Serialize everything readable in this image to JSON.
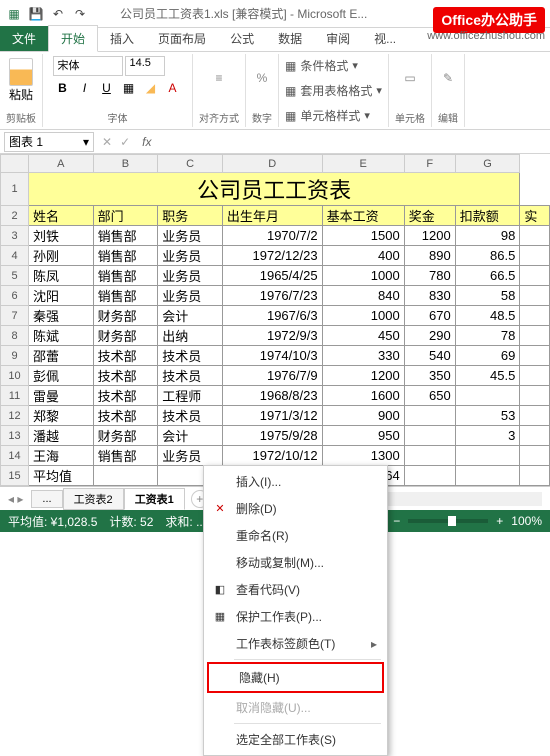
{
  "title": "公司员工工资表1.xls [兼容模式] - Microsoft E...",
  "watermark": "Office办公助手",
  "watermark_url": "www.officezhushou.com",
  "tabs": {
    "file": "文件",
    "home": "开始",
    "insert": "插入",
    "layout": "页面布局",
    "formula": "公式",
    "data": "数据",
    "review": "审阅",
    "view": "视..."
  },
  "ribbon": {
    "clipboard": "剪贴板",
    "paste": "粘贴",
    "font": "字体",
    "font_name": "宋体",
    "font_size": "14.5",
    "align": "对齐方式",
    "number": "数字",
    "cond": "条件格式",
    "tablef": "套用表格格式",
    "cellstyle": "单元格样式",
    "cells": "单元格",
    "edit": "编辑"
  },
  "namebox": "图表 1",
  "cols": [
    "",
    "A",
    "B",
    "C",
    "D",
    "E",
    "F",
    "G"
  ],
  "sheet_title": "公司员工工资表",
  "headers": [
    "姓名",
    "部门",
    "职务",
    "出生年月",
    "基本工资",
    "奖金",
    "扣款额",
    "实"
  ],
  "rows": [
    [
      "刘铁",
      "销售部",
      "业务员",
      "1970/7/2",
      "1500",
      "1200",
      "98",
      ""
    ],
    [
      "孙刚",
      "销售部",
      "业务员",
      "1972/12/23",
      "400",
      "890",
      "86.5",
      ""
    ],
    [
      "陈凤",
      "销售部",
      "业务员",
      "1965/4/25",
      "1000",
      "780",
      "66.5",
      ""
    ],
    [
      "沈阳",
      "销售部",
      "业务员",
      "1976/7/23",
      "840",
      "830",
      "58",
      ""
    ],
    [
      "秦强",
      "财务部",
      "会计",
      "1967/6/3",
      "1000",
      "670",
      "48.5",
      ""
    ],
    [
      "陈斌",
      "财务部",
      "出纳",
      "1972/9/3",
      "450",
      "290",
      "78",
      ""
    ],
    [
      "邵蕾",
      "技术部",
      "技术员",
      "1974/10/3",
      "330",
      "540",
      "69",
      ""
    ],
    [
      "彭佩",
      "技术部",
      "技术员",
      "1976/7/9",
      "1200",
      "350",
      "45.5",
      ""
    ],
    [
      "雷曼",
      "技术部",
      "工程师",
      "1968/8/23",
      "1600",
      "650",
      "",
      ""
    ],
    [
      "郑黎",
      "技术部",
      "技术员",
      "1971/3/12",
      "900",
      "",
      "53",
      ""
    ],
    [
      "潘越",
      "财务部",
      "会计",
      "1975/9/28",
      "950",
      "",
      "3",
      ""
    ],
    [
      "王海",
      "销售部",
      "业务员",
      "1972/10/12",
      "1300",
      "",
      "",
      ""
    ],
    [
      "平均值",
      "",
      "",
      "",
      "935.64",
      "",
      "",
      ""
    ]
  ],
  "sheets": {
    "s1": "...",
    "s2": "工资表2",
    "s3": "工资表1"
  },
  "status": {
    "avg": "平均值: ¥1,028.5",
    "count": "计数: 52",
    "sum": "求和: ...",
    "zoom": "100%"
  },
  "ctx": {
    "insert": "插入(I)...",
    "delete": "删除(D)",
    "rename": "重命名(R)",
    "move": "移动或复制(M)...",
    "code": "查看代码(V)",
    "protect": "保护工作表(P)...",
    "tabcolor": "工作表标签颜色(T)",
    "hide": "隐藏(H)",
    "unhide": "取消隐藏(U)...",
    "selectall": "选定全部工作表(S)"
  }
}
